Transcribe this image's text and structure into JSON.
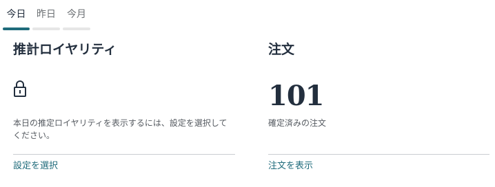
{
  "tabs": [
    {
      "label": "今日",
      "active": true
    },
    {
      "label": "昨日",
      "active": false
    },
    {
      "label": "今月",
      "active": false
    }
  ],
  "royalty_card": {
    "title": "推計ロイヤリティ",
    "icon": "lock-icon",
    "description": "本日の推定ロイヤリティを表示するには、設定を選択してください。",
    "link_label": "設定を選択"
  },
  "orders_card": {
    "title": "注文",
    "value": "101",
    "description": "確定済みの注文",
    "link_label": "注文を表示"
  },
  "colors": {
    "accent": "#1f6b7b",
    "text": "#232f3e",
    "muted": "#555a60",
    "divider": "#c9ccd0"
  }
}
